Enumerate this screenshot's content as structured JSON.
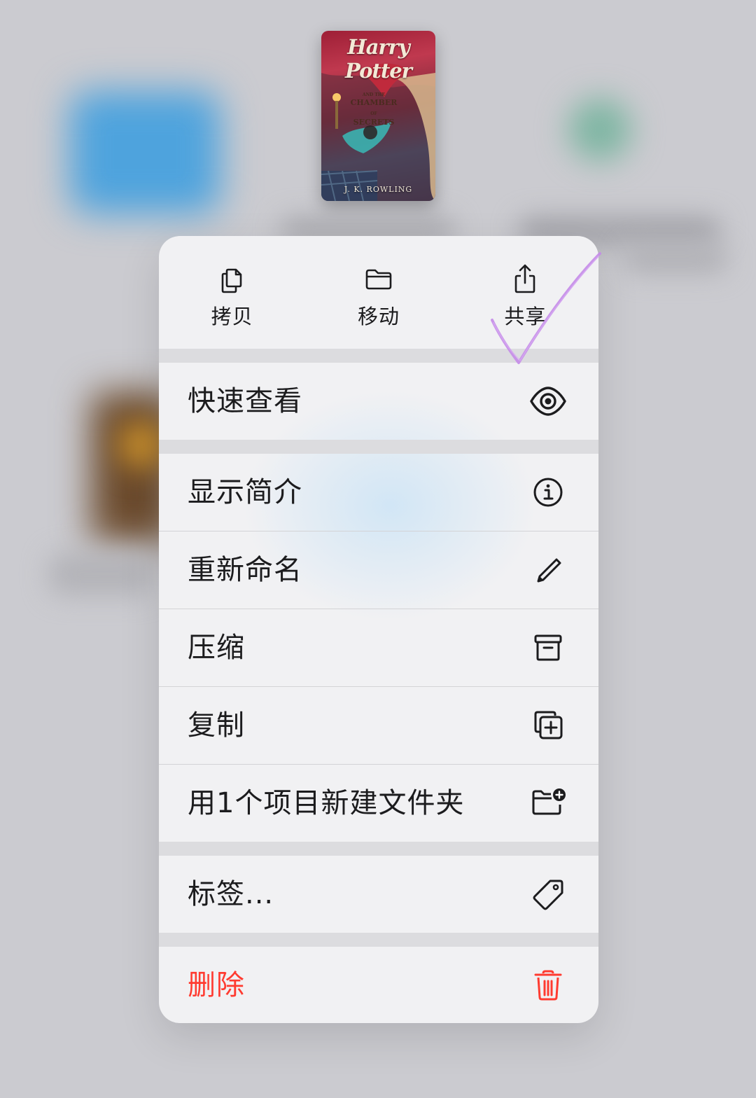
{
  "book": {
    "title": "Harry Potter",
    "subtitle_small": "AND THE",
    "subtitle_1": "CHAMBER",
    "subtitle_2": "SECRETS",
    "subtitle_small_2": "OF",
    "author": "J. K. ROWLING"
  },
  "actions": [
    {
      "label": "拷贝",
      "icon": "copy-icon"
    },
    {
      "label": "移动",
      "icon": "folder-icon"
    },
    {
      "label": "共享",
      "icon": "share-icon"
    }
  ],
  "items": [
    {
      "label": "快速查看",
      "icon": "eye-icon"
    },
    {
      "label": "显示简介",
      "icon": "info-icon"
    },
    {
      "label": "重新命名",
      "icon": "pencil-icon"
    },
    {
      "label": "压缩",
      "icon": "archive-icon"
    },
    {
      "label": "复制",
      "icon": "duplicate-icon"
    },
    {
      "label": "用1个项目新建文件夹",
      "icon": "new-folder-icon"
    },
    {
      "label": "标签...",
      "icon": "tag-icon"
    },
    {
      "label": "删除",
      "icon": "trash-icon"
    }
  ],
  "colors": {
    "destructive": "#ff3b30",
    "annotation_check": "#c48be8"
  }
}
